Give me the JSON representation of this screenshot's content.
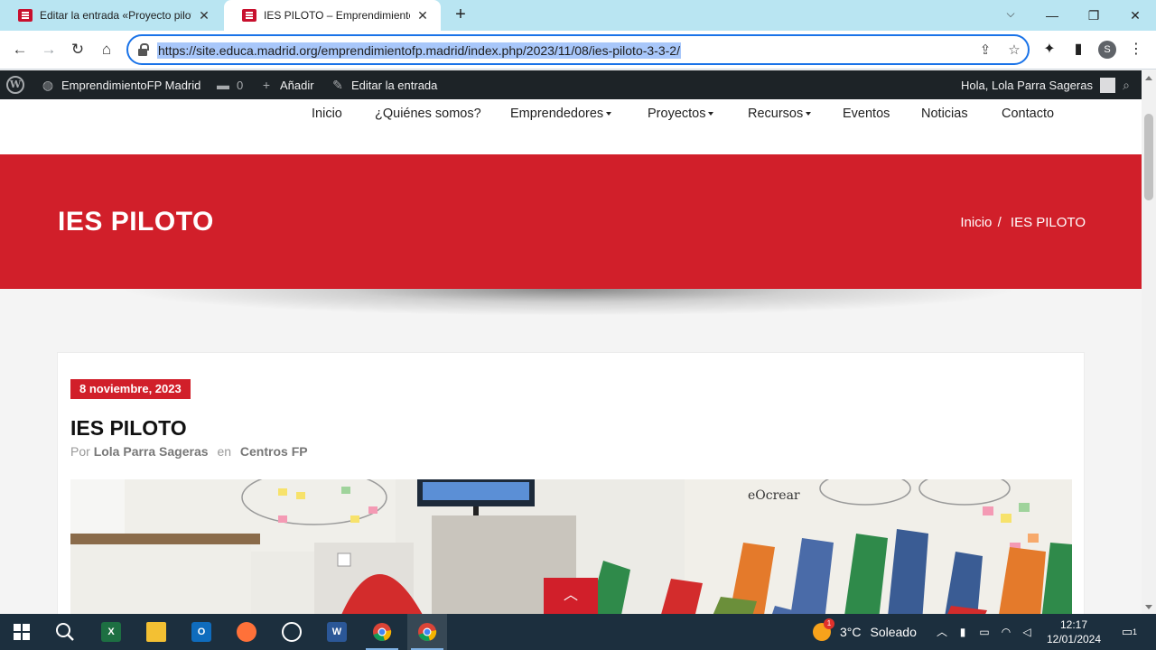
{
  "browser": {
    "tabs": [
      {
        "title": "Editar la entrada «Proyecto piloto",
        "active": false
      },
      {
        "title": "IES PILOTO – EmprendimientoFP Madrid",
        "active": true
      }
    ],
    "new_tab": "+",
    "url": "https://site.educa.madrid.org/emprendimientofp.madrid/index.php/2023/11/08/ies-piloto-3-3-2/",
    "profile_initial": "S"
  },
  "adminbar": {
    "site_name": "EmprendimientoFP Madrid",
    "comments_count": "0",
    "add_label": "Añadir",
    "edit_label": "Editar la entrada",
    "greeting": "Hola, Lola Parra Sageras"
  },
  "nav": {
    "items": [
      {
        "label": "Inicio",
        "dropdown": false
      },
      {
        "label": "¿Quiénes somos?",
        "dropdown": false
      },
      {
        "label": "Emprendedores",
        "dropdown": true
      },
      {
        "label": "Proyectos",
        "dropdown": true
      },
      {
        "label": "Recursos",
        "dropdown": true
      },
      {
        "label": "Eventos",
        "dropdown": false
      },
      {
        "label": "Noticias",
        "dropdown": false
      },
      {
        "label": "Contacto",
        "dropdown": false
      }
    ]
  },
  "banner": {
    "title": "IES PILOTO",
    "breadcrumb_home": "Inicio",
    "breadcrumb_sep": "/",
    "breadcrumb_current": "IES PILOTO"
  },
  "post": {
    "date": "8 noviembre, 2023",
    "title": "IES PILOTO",
    "by_label": "Por",
    "author": "Lola Parra Sageras",
    "in_label": "en",
    "category": "Centros FP"
  },
  "taskbar": {
    "temperature": "3°C",
    "weather": "Soleado",
    "time": "12:17",
    "date": "12/01/2024",
    "weather_badge": "1",
    "notification_count": "1"
  },
  "colors": {
    "brand_red": "#d11f2a",
    "tab_strip": "#b9e5f2",
    "admin_bar": "#1d2327",
    "taskbar": "#1c2f3e"
  }
}
